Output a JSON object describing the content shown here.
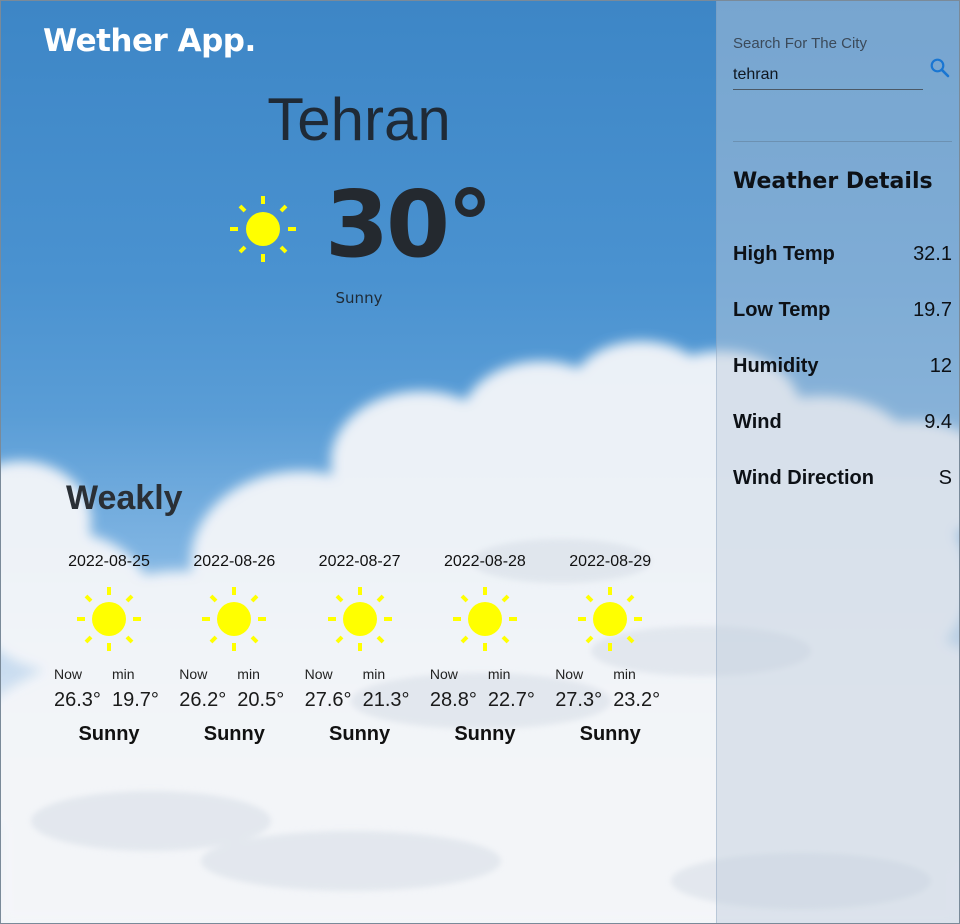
{
  "app": {
    "title": "Wether App."
  },
  "current": {
    "city": "Tehran",
    "temperature": "30°",
    "condition": "Sunny",
    "icon": "sun-icon"
  },
  "weekly": {
    "title": "Weakly",
    "now_label": "Now",
    "min_label": "min",
    "days": [
      {
        "date": "2022-08-25",
        "now": "26.3°",
        "min": "19.7°",
        "condition": "Sunny",
        "icon": "sun-icon"
      },
      {
        "date": "2022-08-26",
        "now": "26.2°",
        "min": "20.5°",
        "condition": "Sunny",
        "icon": "sun-icon"
      },
      {
        "date": "2022-08-27",
        "now": "27.6°",
        "min": "21.3°",
        "condition": "Sunny",
        "icon": "sun-icon"
      },
      {
        "date": "2022-08-28",
        "now": "28.8°",
        "min": "22.7°",
        "condition": "Sunny",
        "icon": "sun-icon"
      },
      {
        "date": "2022-08-29",
        "now": "27.3°",
        "min": "23.2°",
        "condition": "Sunny",
        "icon": "sun-icon"
      }
    ]
  },
  "sidebar": {
    "search": {
      "label": "Search For The City",
      "value": "tehran",
      "icon": "search-icon"
    },
    "details_title": "Weather Details",
    "details": [
      {
        "label": "High Temp",
        "value": "32.1"
      },
      {
        "label": "Low Temp",
        "value": "19.7"
      },
      {
        "label": "Humidity",
        "value": "12"
      },
      {
        "label": "Wind",
        "value": "9.4"
      },
      {
        "label": "Wind Direction",
        "value": "S"
      }
    ]
  },
  "colors": {
    "sky_top": "#3d86c6",
    "sun": "#ffff00",
    "accent_search": "#1976d2",
    "text_dark": "#1f2a36"
  }
}
